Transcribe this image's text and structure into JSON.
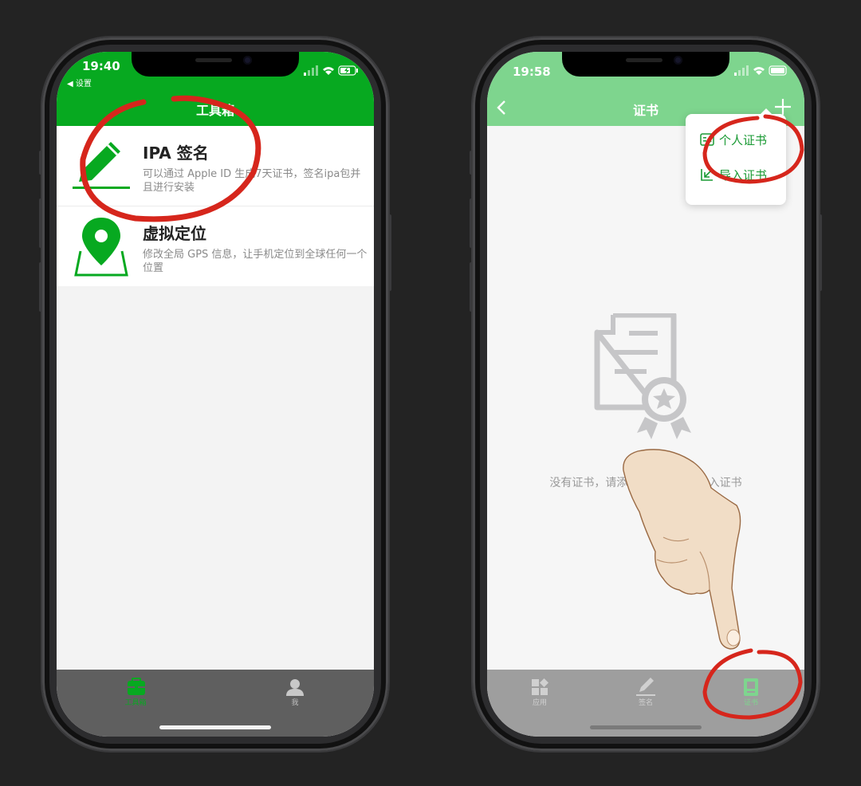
{
  "left": {
    "status_time": "19:40",
    "back_label": "◀ 设置",
    "nav_title": "工具箱",
    "items": [
      {
        "title": "IPA 签名",
        "desc": "可以通过 Apple ID 生成7天证书，签名ipa包并且进行安装",
        "icon": "pencil-icon"
      },
      {
        "title": "虚拟定位",
        "desc": "修改全局 GPS 信息，让手机定位到全球任何一个位置",
        "icon": "map-pin-icon"
      }
    ],
    "tabs": [
      {
        "label": "工具箱",
        "icon": "toolbox-icon",
        "active": true
      },
      {
        "label": "我",
        "icon": "user-icon",
        "active": false
      }
    ]
  },
  "right": {
    "status_time": "19:58",
    "nav_title": "证书",
    "menu": [
      {
        "label": "个人证书",
        "icon": "id-card-icon"
      },
      {
        "label": "导入证书",
        "icon": "import-icon"
      }
    ],
    "empty_text": "没有证书，请添加Apple ID或导入证书",
    "tabs": [
      {
        "label": "应用",
        "icon": "apps-grid-icon",
        "active": false
      },
      {
        "label": "签名",
        "icon": "sign-pen-icon",
        "active": false
      },
      {
        "label": "证书",
        "icon": "certificate-tab-icon",
        "active": true
      }
    ]
  },
  "colors": {
    "brand_green": "#07a920",
    "light_green": "#7ed58e",
    "annotation_red": "#d6261c",
    "background": "#232323"
  }
}
